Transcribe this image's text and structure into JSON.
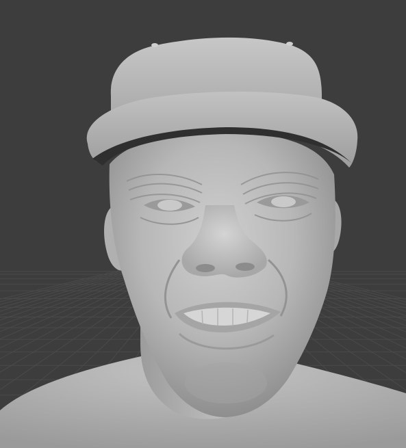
{
  "viewport": {
    "mode": "3d-viewport",
    "shading": "solid",
    "background_color": "#3d3d3d",
    "grid_color": "#4a4a4a",
    "model_color": "#b8b8b8"
  },
  "scene": {
    "objects": [
      {
        "name": "head-sculpt",
        "kind": "mesh"
      },
      {
        "name": "cap",
        "kind": "mesh"
      }
    ]
  }
}
